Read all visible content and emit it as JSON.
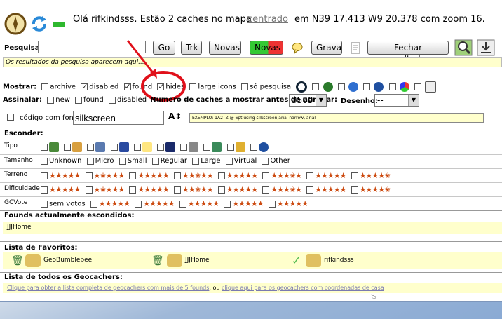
{
  "header": {
    "greeting": "Olá rifkindsss. Estão 2 caches no mapa",
    "center_link": "centrado",
    "position_text": "em N39 17.413 W9 20.378 com zoom 16."
  },
  "search": {
    "label": "Pesquisa:",
    "input_value": "",
    "buttons": {
      "go": "Go",
      "trk": "Trk",
      "novas1": "Novas",
      "novas2": "Novas",
      "grava": "Grava",
      "fechar": "Fechar resultados"
    },
    "results_placeholder": "Os resultados da pesquisa aparecem aqui..."
  },
  "mostrar": {
    "label": "Mostrar:",
    "options": [
      {
        "label": "archive",
        "checked": false
      },
      {
        "label": "disabled",
        "checked": true
      },
      {
        "label": "found",
        "checked": true
      },
      {
        "label": "hides",
        "checked": true
      },
      {
        "label": "large icons",
        "checked": false
      },
      {
        "label": "só pesquisa",
        "checked": false
      }
    ]
  },
  "assinalar": {
    "label": "Assinalar:",
    "options": [
      "new",
      "found",
      "disabled"
    ],
    "numero_label": "Numero de caches a mostrar antes de agrupar:",
    "numero_value": "3500",
    "desenho_label": "Desenho:",
    "desenho_value": "--"
  },
  "font": {
    "label": "código com fonte:",
    "value": "silkscreen",
    "example": "EXEMPLO: 1A2TZ @ 6pt using silkscreen,arial narrow, arial"
  },
  "esconder": {
    "label": "Esconder:",
    "rows": {
      "tipo": "Tipo",
      "tamanho": "Tamanho",
      "terreno": "Terreno",
      "dificuldade": "Dificuldade",
      "gcvote": "GCVote"
    },
    "sizes": [
      "Unknown",
      "Micro",
      "Small",
      "Regular",
      "Large",
      "Virtual",
      "Other"
    ],
    "gcvote_none": "sem votos"
  },
  "founds": {
    "title": "Founds actualmente escondidos:",
    "value": "JJJHome"
  },
  "favoritos": {
    "title": "Lista de Favoritos:",
    "users": [
      "GeoBumblebee",
      "JJJHome",
      "rifkindsss"
    ]
  },
  "geocachers": {
    "title": "Lista de todos os Geocachers:",
    "link1": "Clique para obter a lista completa de geocachers com mais de 5 founds",
    "ou": "ou",
    "link2": "clique aqui para os geocachers com coordenadas de casa"
  },
  "colors": {
    "star": "#cc4a10",
    "highlight_circle": "#e0101a",
    "arrow": "#e0101a",
    "yellow": "#ffffcc"
  }
}
